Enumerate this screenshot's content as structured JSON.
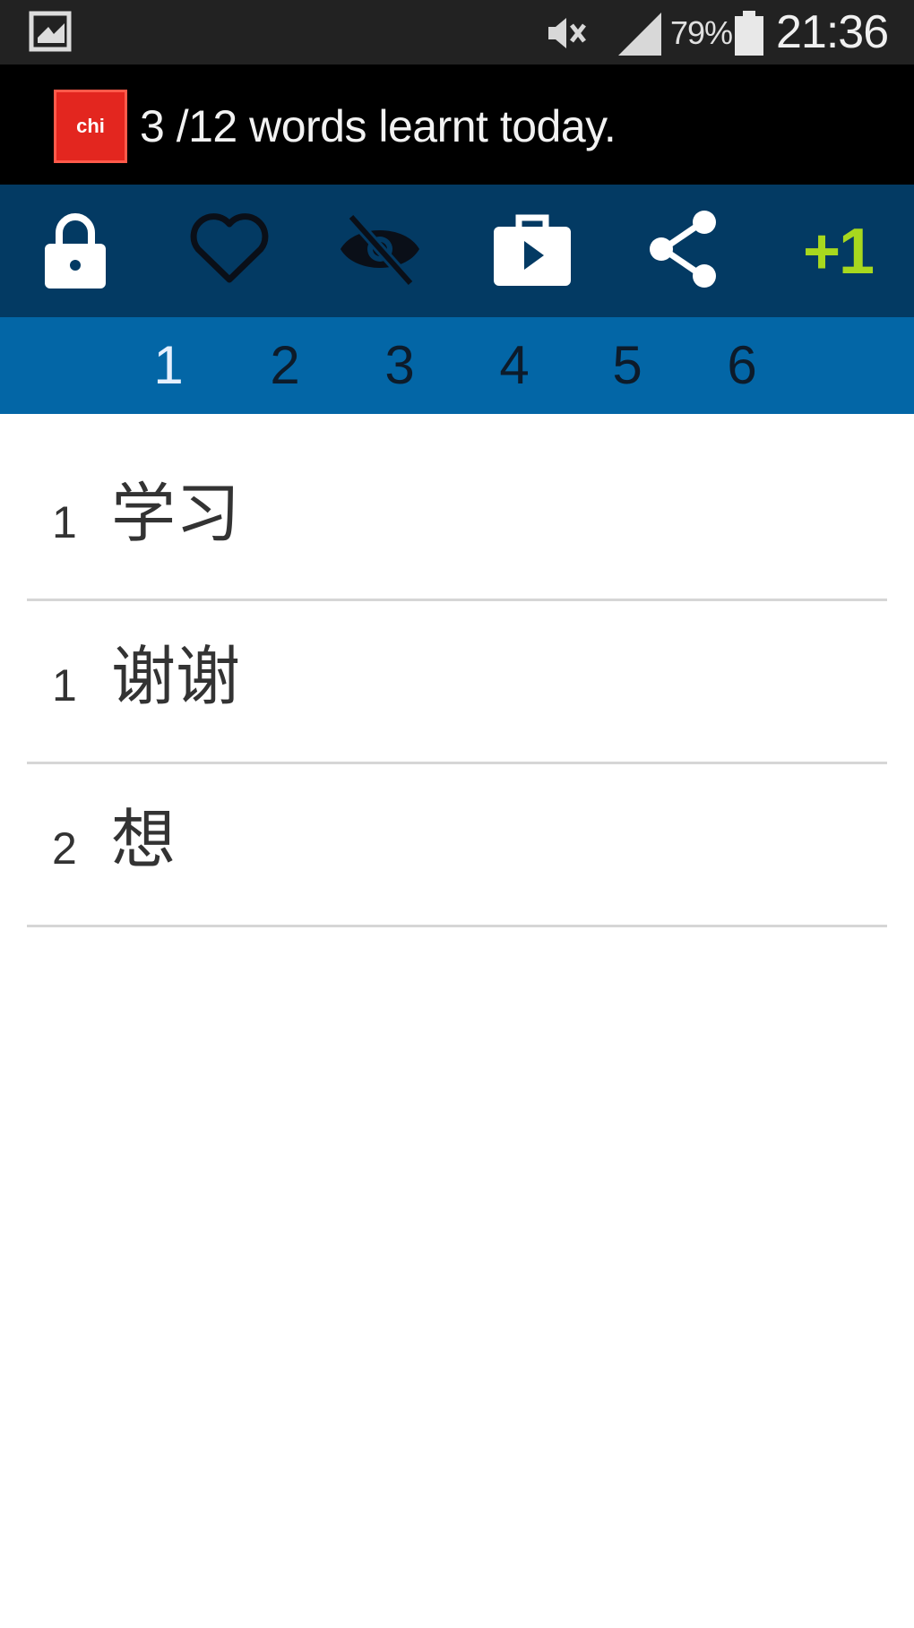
{
  "status_bar": {
    "battery_percent": "79%",
    "time": "21:36",
    "icons": [
      "screenshot-icon",
      "mute-icon",
      "signal-icon",
      "battery-icon"
    ]
  },
  "title_bar": {
    "logo_text": "chi",
    "title": "3 /12 words learnt today."
  },
  "toolbar": {
    "icons": [
      "lock-icon",
      "heart-icon",
      "eye-off-icon",
      "play-store-icon",
      "share-icon"
    ],
    "plus_one": "+1",
    "accent_color": "#a8d81e",
    "background_color": "#033a63"
  },
  "tabs": {
    "items": [
      "1",
      "2",
      "3",
      "4",
      "5",
      "6"
    ],
    "active_index": 0,
    "background_color": "#0366a6"
  },
  "words": [
    {
      "number": "1",
      "word": "学习"
    },
    {
      "number": "1",
      "word": "谢谢"
    },
    {
      "number": "2",
      "word": "想"
    }
  ]
}
